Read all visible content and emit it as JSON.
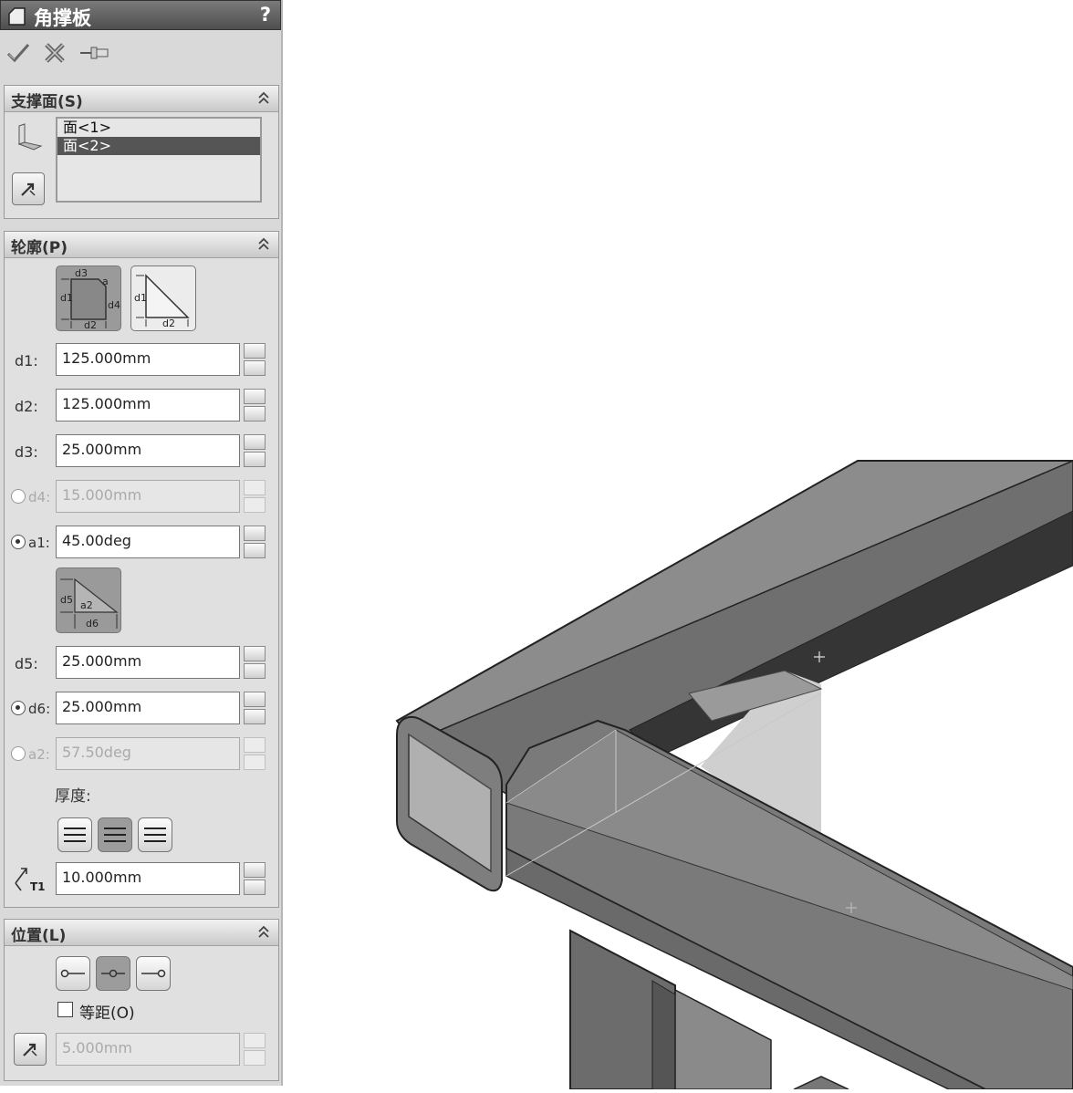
{
  "window": {
    "title": "角撑板",
    "help": "?"
  },
  "actions": {
    "ok_icon": "checkmark-icon",
    "cancel_icon": "cancel-x-icon",
    "pin_icon": "pushpin-icon"
  },
  "support_faces": {
    "header": "支撑面(S)",
    "items": [
      {
        "label": "面<1>",
        "selected": false
      },
      {
        "label": "面<2>",
        "selected": true
      }
    ]
  },
  "profile": {
    "header": "轮廓(P)",
    "profile_buttons": [
      {
        "name": "chamfered-profile",
        "labels": [
          "d1",
          "d2",
          "d3",
          "d4",
          "a"
        ],
        "active": true
      },
      {
        "name": "triangular-profile",
        "labels": [
          "d1",
          "d2"
        ],
        "active": false
      }
    ],
    "params": [
      {
        "label": "d1:",
        "value": "125.000mm",
        "radio": null,
        "enabled": true
      },
      {
        "label": "d2:",
        "value": "125.000mm",
        "radio": null,
        "enabled": true
      },
      {
        "label": "d3:",
        "value": "25.000mm",
        "radio": null,
        "enabled": true
      },
      {
        "label": "d4:",
        "value": "15.000mm",
        "radio": false,
        "enabled": false
      },
      {
        "label": "a1:",
        "value": "45.00deg",
        "radio": true,
        "enabled": true
      }
    ],
    "chamfer_button_labels": [
      "d5",
      "a2",
      "d6"
    ],
    "chamfer_params": [
      {
        "label": "d5:",
        "value": "25.000mm",
        "radio": null,
        "enabled": true
      },
      {
        "label": "d6:",
        "value": "25.000mm",
        "radio": true,
        "enabled": true
      },
      {
        "label": "a2:",
        "value": "57.50deg",
        "radio": false,
        "enabled": false
      }
    ],
    "thickness_label": "厚度:",
    "thickness_options": [
      "thickness-one-side",
      "thickness-symmetric",
      "thickness-other-side"
    ],
    "thickness_selected": 1,
    "t1_symbol": "T1",
    "t1_value": "10.000mm"
  },
  "position": {
    "header": "位置(L)",
    "location_options": [
      "location-start",
      "location-middle",
      "location-end"
    ],
    "location_selected": 1,
    "offset_label": "等距(O)",
    "offset_checked": false,
    "offset_value": "5.000mm"
  }
}
